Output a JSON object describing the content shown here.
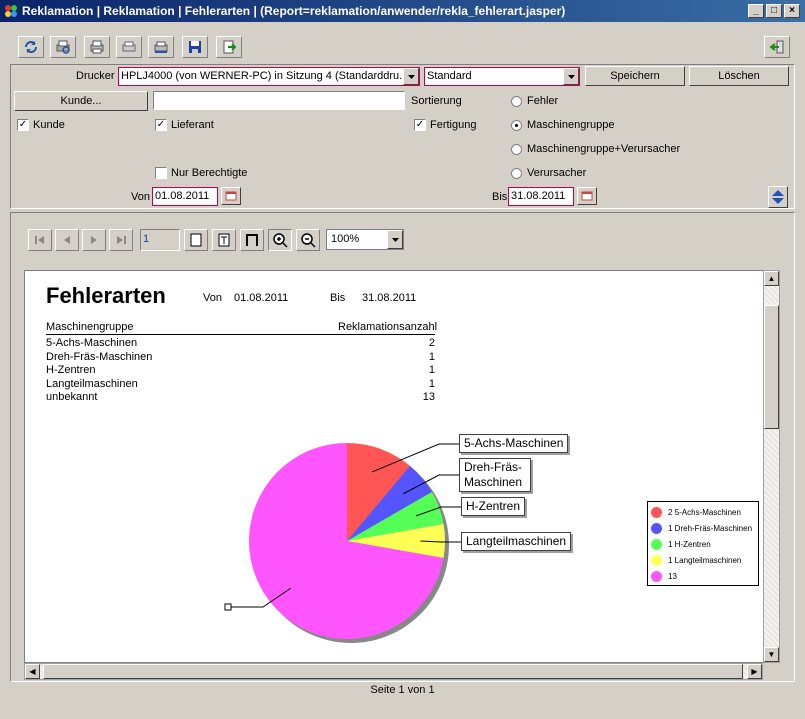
{
  "window": {
    "title": "Reklamation | Reklamation | Fehlerarten | (Report=reklamation/anwender/rekla_fehlerart.jasper)",
    "min": "_",
    "max": "□",
    "close": "×"
  },
  "toolbar": {
    "icons": [
      "refresh-icon",
      "print-preview-icon",
      "print-icon",
      "printer-icon",
      "printer-setup-icon",
      "save-icon",
      "export-icon"
    ],
    "exit_icon": "exit-icon"
  },
  "params": {
    "drucker_label": "Drucker",
    "drucker_value": "HPLJ4000 (von WERNER-PC) in Sitzung 4 (Standarddru...",
    "format_value": "Standard",
    "speichern": "Speichern",
    "loeschen": "Löschen",
    "kunde_button": "Kunde...",
    "kunde_value": "",
    "sortierung_label": "Sortierung",
    "checkboxes": {
      "kunde": "Kunde",
      "lieferant": "Lieferant",
      "fertigung": "Fertigung",
      "nur_berechtigte": "Nur Berechtigte"
    },
    "radios": {
      "fehler": "Fehler",
      "maschinengruppe": "Maschinengruppe",
      "maschinengruppe_verursacher": "Maschinengruppe+Verursacher",
      "verursacher": "Verursacher"
    },
    "selected_radio": "maschinengruppe",
    "von_label": "Von",
    "von_value": "01.08.2011",
    "bis_label": "Bis",
    "bis_value": "31.08.2011"
  },
  "viewer": {
    "page_field": "1",
    "zoom": "100%",
    "status": "Seite 1 von 1"
  },
  "report": {
    "title": "Fehlerarten",
    "von_label": "Von",
    "von_value": "01.08.2011",
    "bis_label": "Bis",
    "bis_value": "31.08.2011",
    "col_group": "Maschinengruppe",
    "col_count": "Reklamationsanzahl",
    "rows": [
      {
        "name": "5-Achs-Maschinen",
        "count": "2"
      },
      {
        "name": "Dreh-Fräs-Maschinen",
        "count": "1"
      },
      {
        "name": "H-Zentren",
        "count": "1"
      },
      {
        "name": "Langteilmaschinen",
        "count": "1"
      },
      {
        "name": "unbekannt",
        "count": "13"
      }
    ]
  },
  "chart_data": {
    "type": "pie",
    "categories": [
      "5-Achs-Maschinen",
      "Dreh-Fräs-Maschinen",
      "H-Zentren",
      "Langteilmaschinen",
      "unbekannt"
    ],
    "values": [
      2,
      1,
      1,
      1,
      13
    ],
    "colors": [
      "#ff5555",
      "#5555ff",
      "#55ff55",
      "#ffff55",
      "#ff55ff"
    ],
    "callouts": [
      "5-Achs-Maschinen",
      "Dreh-Fräs-Maschinen",
      "H-Zentren",
      "Langteilmaschinen",
      ""
    ],
    "legend": [
      "2 5-Achs-Maschinen",
      "1 Dreh-Fräs-Maschinen",
      "1 H-Zentren",
      "1 Langteilmaschinen",
      "13"
    ],
    "legend_position": "right"
  }
}
